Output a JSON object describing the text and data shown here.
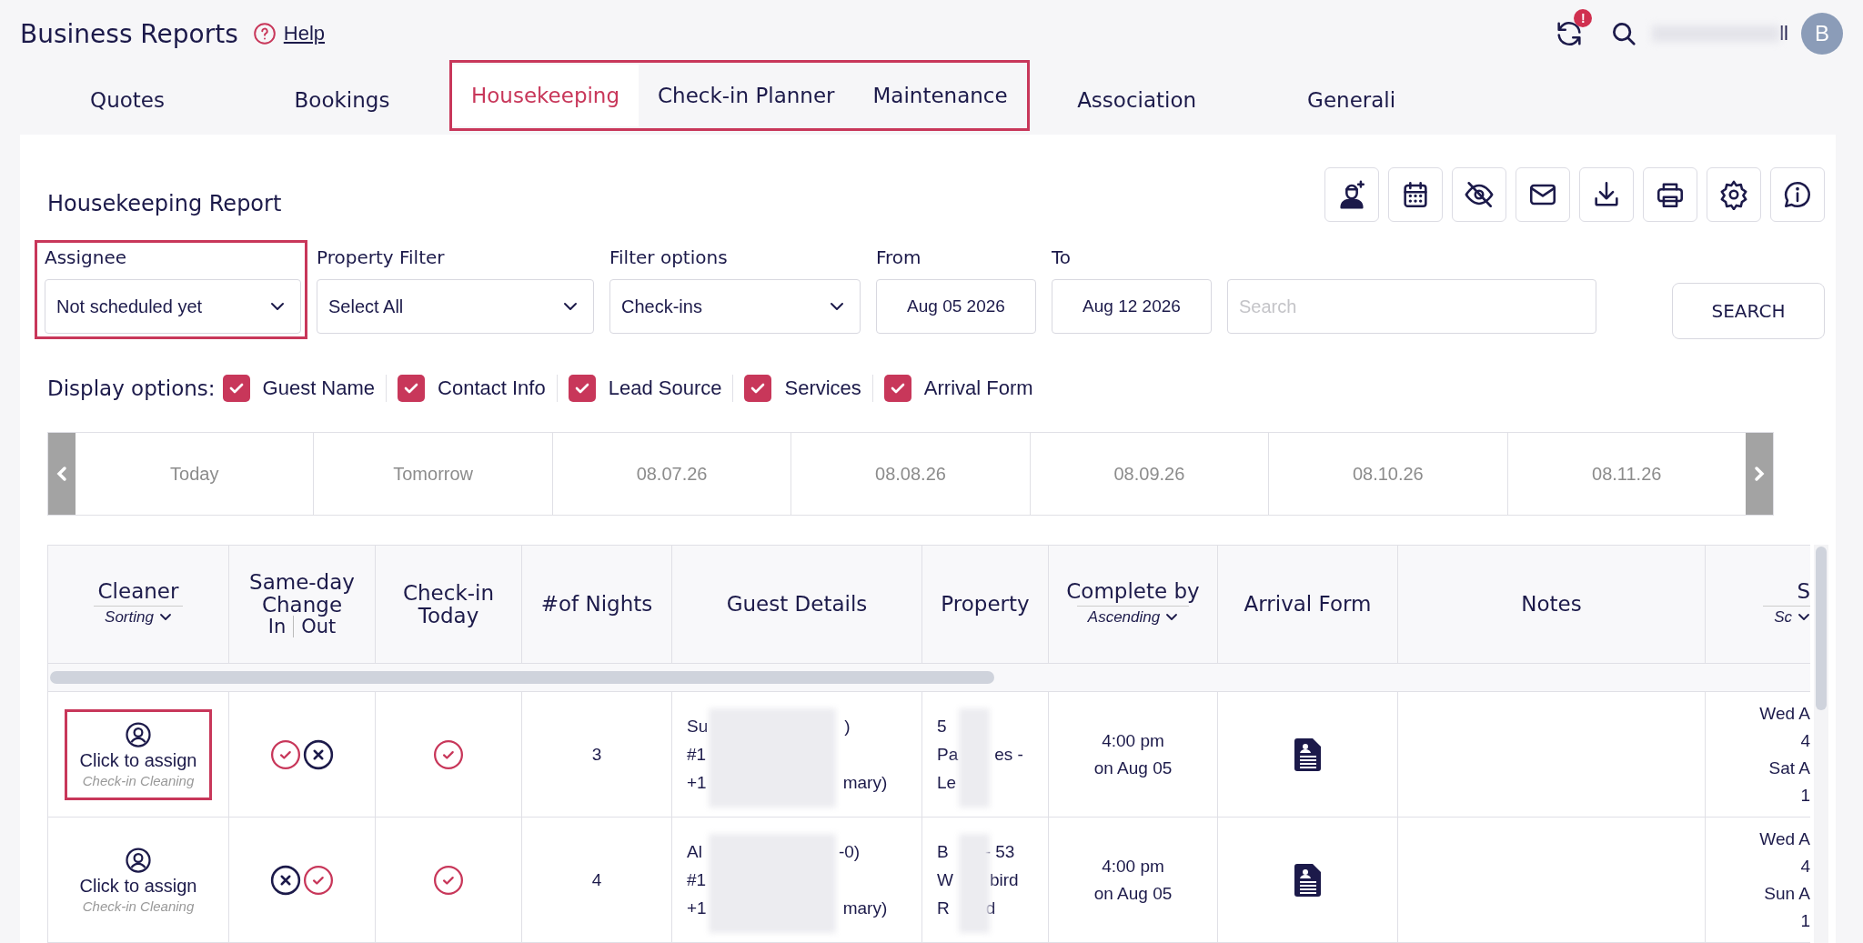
{
  "header": {
    "title": "Business Reports",
    "help": "Help",
    "notification_badge": "!",
    "user_name_end": "ll",
    "avatar_initial": "B"
  },
  "tabs": [
    {
      "label": "Quotes",
      "selected": false,
      "highlighted": false
    },
    {
      "label": "Bookings",
      "selected": false,
      "highlighted": false
    },
    {
      "label": "Housekeeping",
      "selected": true,
      "highlighted": true
    },
    {
      "label": "Check-in Planner",
      "selected": false,
      "highlighted": true
    },
    {
      "label": "Maintenance",
      "selected": false,
      "highlighted": true
    },
    {
      "label": "Association",
      "selected": false,
      "highlighted": false
    },
    {
      "label": "Generali",
      "selected": false,
      "highlighted": false
    }
  ],
  "report": {
    "title": "Housekeeping Report",
    "toolbar": [
      {
        "kind": "assign-cleaner"
      },
      {
        "kind": "calendar"
      },
      {
        "kind": "hide"
      },
      {
        "kind": "email"
      },
      {
        "kind": "download"
      },
      {
        "kind": "print"
      },
      {
        "kind": "settings"
      },
      {
        "kind": "info"
      }
    ],
    "filters": [
      {
        "kind": "select",
        "label": "Assignee",
        "value": "Not scheduled yet",
        "highlighted": true
      },
      {
        "kind": "select",
        "label": "Property Filter",
        "value": "Select All",
        "highlighted": false
      },
      {
        "kind": "select",
        "label": "Filter options",
        "value": "Check-ins",
        "highlighted": false
      },
      {
        "kind": "date",
        "label": "From",
        "value": "Aug 05 2026",
        "highlighted": false
      },
      {
        "kind": "date",
        "label": "To",
        "value": "Aug 12 2026",
        "highlighted": false
      },
      {
        "kind": "search",
        "placeholder": "Search",
        "highlighted": false
      }
    ],
    "search_button": "SEARCH",
    "display_options": {
      "label": "Display options:",
      "options": [
        {
          "label": "Guest Name",
          "checked": true
        },
        {
          "label": "Contact Info",
          "checked": true
        },
        {
          "label": "Lead Source",
          "checked": true
        },
        {
          "label": "Services",
          "checked": true
        },
        {
          "label": "Arrival Form",
          "checked": true
        }
      ]
    },
    "dates": [
      "Today",
      "Tomorrow",
      "08.07.26",
      "08.08.26",
      "08.09.26",
      "08.10.26",
      "08.11.26"
    ],
    "table": {
      "columns": [
        {
          "title": "Cleaner",
          "sort": "Sorting"
        },
        {
          "title": "Same-day Change",
          "sub": [
            "In",
            "Out"
          ]
        },
        {
          "title": "Check-in Today"
        },
        {
          "title": "#of Nights"
        },
        {
          "title": "Guest Details"
        },
        {
          "title": "Property"
        },
        {
          "title": "Complete by",
          "sort": "Ascending"
        },
        {
          "title": "Arrival Form"
        },
        {
          "title": "Notes"
        },
        {
          "title": "S",
          "sort": "Sc"
        }
      ],
      "rows": [
        {
          "cleaner": {
            "action": "Click to assign",
            "type": "Check-in Cleaning",
            "highlighted": true
          },
          "same_day_in": true,
          "same_day_out": false,
          "checkin_today": true,
          "nights": "3",
          "guest_details": [
            {
              "start": "Su",
              "end": ")"
            },
            {
              "start": "#1"
            },
            {
              "start": "+1",
              "end": "mary)"
            }
          ],
          "property": [
            {
              "start": "5"
            },
            {
              "start": "Pa",
              "end": "es -"
            },
            {
              "start": "Le"
            }
          ],
          "complete_by": [
            "4:00 pm",
            "on Aug 05"
          ],
          "arrival_form": true,
          "column_10": [
            "Wed A",
            "4",
            "Sat A",
            "1"
          ]
        },
        {
          "cleaner": {
            "action": "Click to assign",
            "type": "Check-in Cleaning",
            "highlighted": false
          },
          "same_day_in": false,
          "same_day_out": true,
          "checkin_today": true,
          "nights": "4",
          "guest_details": [
            {
              "start": "Al",
              "end": "-0)"
            },
            {
              "start": "#1"
            },
            {
              "start": "+1",
              "end": "mary)"
            }
          ],
          "property": [
            {
              "start": "B",
              "end": "- 53"
            },
            {
              "start": "W",
              "end": "bird"
            },
            {
              "start": "R",
              "end": "d"
            }
          ],
          "complete_by": [
            "4:00 pm",
            "on Aug 05"
          ],
          "arrival_form": true,
          "column_10": [
            "Wed A",
            "4",
            "Sun A",
            "1"
          ]
        }
      ]
    }
  }
}
